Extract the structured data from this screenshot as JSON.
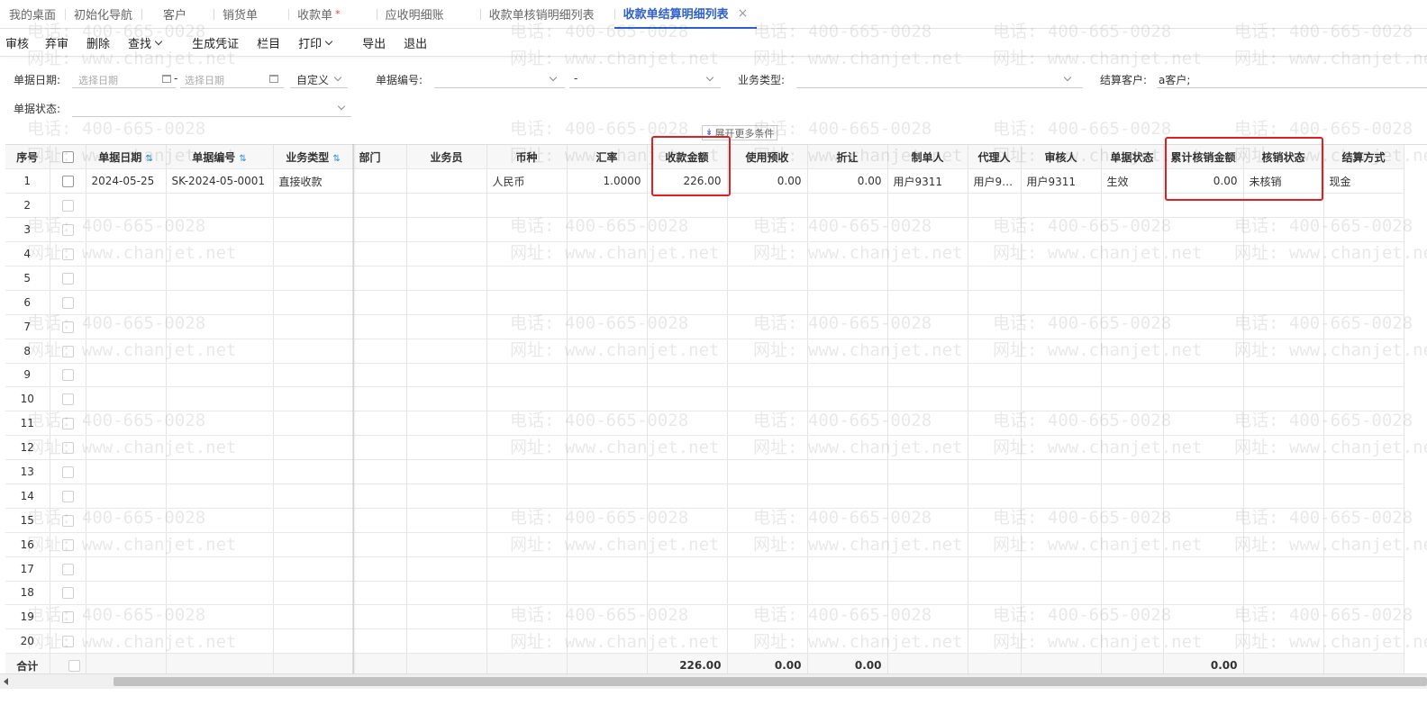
{
  "tabs": [
    {
      "label": "我的桌面"
    },
    {
      "label": "初始化导航"
    },
    {
      "label": "客户"
    },
    {
      "label": "销货单"
    },
    {
      "label": "收款单",
      "required_mark": "*"
    },
    {
      "label": "应收明细账"
    },
    {
      "label": "收款单核销明细列表"
    },
    {
      "label": "收款单结算明细列表",
      "active": true,
      "close": "×"
    }
  ],
  "toolbar": {
    "audit": "审核",
    "unaudit": "弃审",
    "delete": "删除",
    "find": "查找",
    "voucher": "生成凭证",
    "columns": "栏目",
    "print": "打印",
    "export": "导出",
    "exit": "退出"
  },
  "filters": {
    "date_label": "单据日期:",
    "date_from_placeholder": "选择日期",
    "date_sep": "-",
    "date_to_placeholder": "选择日期",
    "date_mode": "自定义",
    "docno_label": "单据编号:",
    "docno_sep": "-",
    "biztype_label": "业务类型:",
    "customer_label": "结算客户:",
    "customer_value": "a客户;",
    "status_label": "单据状态:",
    "expand": "展开更多条件",
    "expand_icon": "double-chevron-down"
  },
  "grid": {
    "headers": [
      "序号",
      "",
      "单据日期",
      "单据编号",
      "业务类型",
      "部门",
      "业务员",
      "币种",
      "汇率",
      "收款金额",
      "使用预收",
      "折让",
      "制单人",
      "代理人",
      "审核人",
      "单据状态",
      "累计核销金额",
      "核销状态",
      "结算方式"
    ],
    "rows": [
      {
        "no": "1",
        "date": "2024-05-25",
        "code": "SK-2024-05-0001",
        "biztype": "直接收款",
        "dept": "",
        "salesman": "",
        "currency": "人民币",
        "rate": "1.0000",
        "amount": "226.00",
        "prepay": "0.00",
        "discount": "0.00",
        "maker": "用户9311",
        "agent": "用户9…",
        "auditor": "用户9311",
        "status": "生效",
        "settled": "0.00",
        "settle_status": "未核销",
        "method": "现金"
      },
      {
        "no": "2"
      },
      {
        "no": "3"
      },
      {
        "no": "4"
      },
      {
        "no": "5"
      },
      {
        "no": "6"
      },
      {
        "no": "7"
      },
      {
        "no": "8"
      },
      {
        "no": "9"
      },
      {
        "no": "10"
      },
      {
        "no": "11"
      },
      {
        "no": "12"
      },
      {
        "no": "13"
      },
      {
        "no": "14"
      },
      {
        "no": "15"
      },
      {
        "no": "16"
      },
      {
        "no": "17"
      },
      {
        "no": "18"
      },
      {
        "no": "19"
      },
      {
        "no": "20"
      }
    ],
    "total": {
      "label": "合计",
      "amount": "226.00",
      "prepay": "0.00",
      "discount": "0.00",
      "settled": "0.00"
    }
  },
  "watermark": {
    "phone": "电话: 400-665-0028",
    "site": "网址: www.chanjet.net"
  },
  "colors": {
    "accent": "#2d5fd0",
    "highlight": "#e02020"
  }
}
